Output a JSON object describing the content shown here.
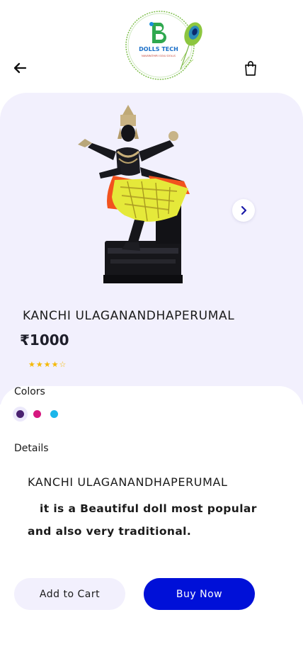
{
  "header": {
    "logo": {
      "brand": "DOLLS TECH",
      "tagline": "NAVARATHIRI GOLU DOLLS",
      "letter": "B"
    },
    "back_icon": "arrow-left-icon",
    "bag_icon": "shopping-bag-icon"
  },
  "product": {
    "name": "KANCHI ULAGANANDHAPERUMAL",
    "price": "₹1000",
    "rating": 4,
    "rating_max": 5,
    "next_icon": "chevron-right-icon"
  },
  "colors": {
    "label": "Colors",
    "options": [
      "#4a2270",
      "#d6177f",
      "#1bb6ea"
    ],
    "selected_index": 0
  },
  "details": {
    "label": "Details",
    "title": "KANCHI ULAGANANDHAPERUMAL",
    "body": "it is a Beautiful doll most popular and also very traditional."
  },
  "actions": {
    "add_to_cart": "Add to Cart",
    "buy_now": "Buy Now"
  },
  "theme": {
    "accent": "#0010d8",
    "panel": "#f2f0fd",
    "star": "#f5b800"
  }
}
